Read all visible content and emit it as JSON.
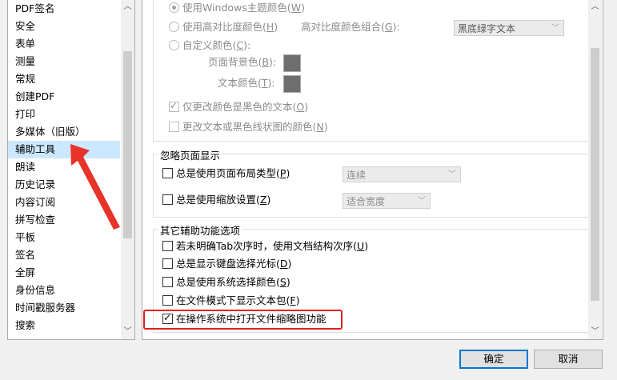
{
  "sidebar": {
    "items": [
      {
        "label": "PDF签名"
      },
      {
        "label": "安全"
      },
      {
        "label": "表单"
      },
      {
        "label": "测量"
      },
      {
        "label": "常规"
      },
      {
        "label": "创建PDF"
      },
      {
        "label": "打印"
      },
      {
        "label": "多媒体（旧版）"
      },
      {
        "label": "辅助工具",
        "selected": true
      },
      {
        "label": "朗读"
      },
      {
        "label": "历史记录"
      },
      {
        "label": "内容订阅"
      },
      {
        "label": "拼写检查"
      },
      {
        "label": "平板"
      },
      {
        "label": "签名"
      },
      {
        "label": "全屏"
      },
      {
        "label": "身份信息"
      },
      {
        "label": "时间戳服务器"
      },
      {
        "label": "搜索"
      }
    ]
  },
  "doc_colors": {
    "use_windows_theme": {
      "label": "使用Windows主题颜色(",
      "key": "W",
      "suffix": ")",
      "selected": true
    },
    "high_contrast": {
      "label": "使用高对比度颜色(",
      "key": "H",
      "suffix": ")"
    },
    "combo_label": {
      "label": "高对比度颜色组合(",
      "key": "G",
      "suffix": "):"
    },
    "combo_value": "黑底绿字文本",
    "custom": {
      "label": "自定义颜色(",
      "key": "C",
      "suffix": "):"
    },
    "page_bg": {
      "label": "页面背景色(",
      "key": "B",
      "suffix": "):"
    },
    "text_color": {
      "label": "文本颜色(",
      "key": "T",
      "suffix": "):"
    },
    "only_black_text": {
      "label": "仅更改颜色是黑色的文本(",
      "key": "O",
      "suffix": ")",
      "checked": true
    },
    "change_lineart": {
      "label": "更改文本或黑色线状图的颜色(",
      "key": "N",
      "suffix": ")",
      "checked": false
    }
  },
  "override_display": {
    "title": "忽略页面显示",
    "page_layout": {
      "label": "总是使用页面布局类型(",
      "key": "P",
      "suffix": ")",
      "value": "连续",
      "checked": false
    },
    "zoom": {
      "label": "总是使用缩放设置(",
      "key": "Z",
      "suffix": ")",
      "value": "适合宽度",
      "checked": false
    }
  },
  "other_options": {
    "title": "其它辅助功能选项",
    "items": [
      {
        "label": "若未明确Tab次序时，使用文档结构次序(",
        "key": "U",
        "suffix": ")",
        "checked": false
      },
      {
        "label": "总是显示键盘选择光标(",
        "key": "D",
        "suffix": ")",
        "checked": false
      },
      {
        "label": "总是使用系统选择颜色(",
        "key": "S",
        "suffix": ")",
        "checked": false
      },
      {
        "label": "在文件模式下显示文本包(",
        "key": "F",
        "suffix": ")",
        "checked": false
      },
      {
        "label": "在操作系统中打开文件缩略图功能",
        "key": "",
        "suffix": "",
        "checked": true
      }
    ]
  },
  "buttons": {
    "ok": "确定",
    "cancel": "取消"
  },
  "colors": {
    "highlight_box": "#e02020",
    "arrow": "#e8332a",
    "selection": "#cce8ff",
    "primary_border": "#0078d7"
  }
}
